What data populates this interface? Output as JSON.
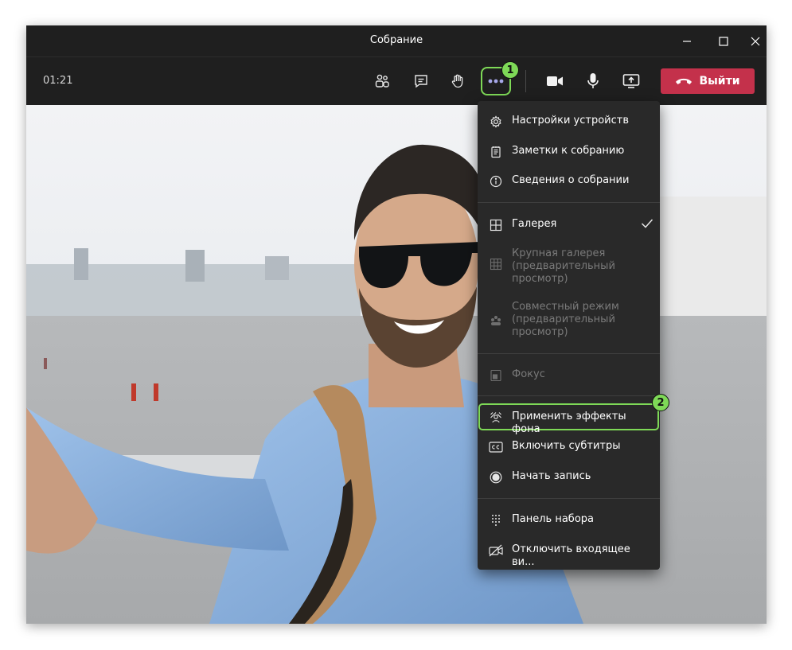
{
  "window": {
    "title": "Собрание",
    "controls": [
      "minimize-icon",
      "maximize-icon",
      "close-icon"
    ]
  },
  "toolbar": {
    "timer": "01:21",
    "buttons": [
      "people-icon",
      "chat-icon",
      "raise-hand-icon",
      "more-actions-icon",
      "camera-icon",
      "microphone-icon",
      "share-screen-icon"
    ],
    "leave_label": "Выйти",
    "leave_color": "#c4314b"
  },
  "annotations": {
    "badge_1": "1",
    "badge_2": "2",
    "highlight_color": "#7ed957"
  },
  "menu": {
    "items": [
      {
        "label": "Настройки устройств",
        "icon": "gear-icon",
        "enabled": true
      },
      {
        "label": "Заметки к собранию",
        "icon": "notes-icon",
        "enabled": true
      },
      {
        "label": "Сведения о собрании",
        "icon": "info-icon",
        "enabled": true
      },
      {
        "label": "Галерея",
        "icon": "gallery-icon",
        "enabled": true,
        "checked": true
      },
      {
        "label": "Крупная галерея\n(предварительный\nпросмотр)",
        "icon": "large-gallery-icon",
        "enabled": false
      },
      {
        "label": "Совместный режим\n(предварительный\nпросмотр)",
        "icon": "together-mode-icon",
        "enabled": false
      },
      {
        "label": "Фокус",
        "icon": "focus-icon",
        "enabled": false
      },
      {
        "label": "Применить эффекты фона",
        "icon": "background-effects-icon",
        "enabled": true,
        "highlighted": true
      },
      {
        "label": "Включить субтитры",
        "icon": "captions-icon",
        "enabled": true
      },
      {
        "label": "Начать запись",
        "icon": "record-icon",
        "enabled": true
      },
      {
        "label": "Панель набора",
        "icon": "dialpad-icon",
        "enabled": true
      },
      {
        "label": "Отключить входящее ви...",
        "icon": "video-off-icon",
        "enabled": true
      }
    ]
  }
}
